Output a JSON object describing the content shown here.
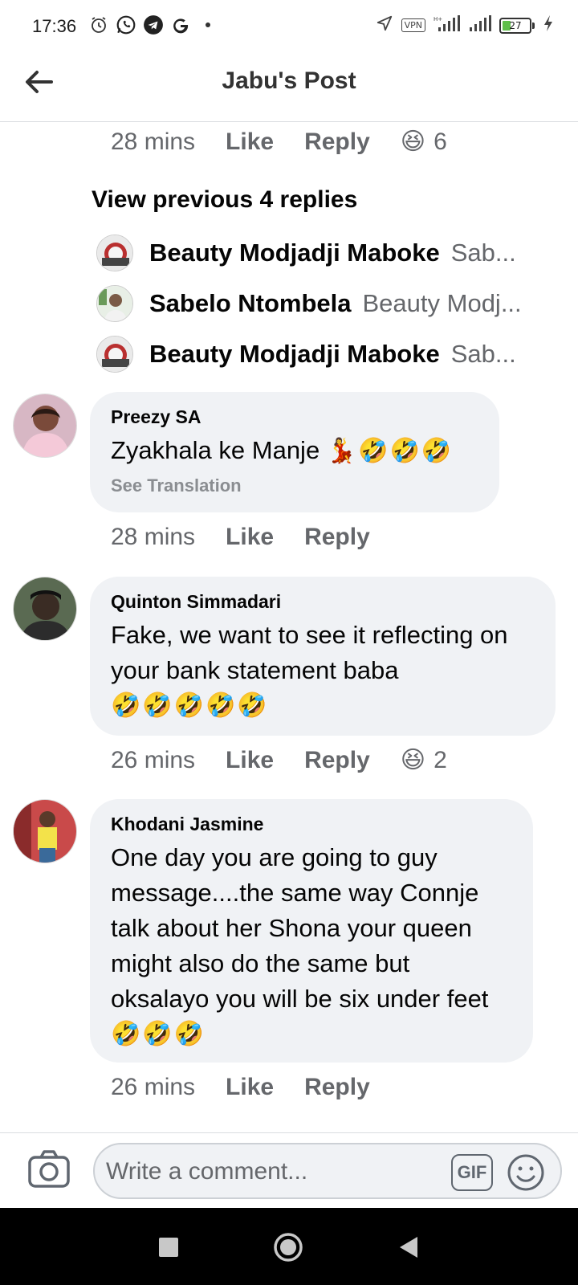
{
  "status_bar": {
    "time": "17:36",
    "left_icons": [
      "alarm-icon",
      "whatsapp-icon",
      "telegram-icon",
      "google-icon",
      "dot-icon"
    ],
    "vpn_label": "VPN",
    "battery_level": "27",
    "battery_fraction": 0.27
  },
  "header": {
    "title": "Jabu's Post",
    "back_icon": "back-arrow-icon"
  },
  "feed": {
    "top_meta": {
      "time": "28 mins",
      "like": "Like",
      "reply": "Reply",
      "reaction_emoji": "😆",
      "reaction_count": "6"
    },
    "view_previous": "View previous 4 replies",
    "replies": [
      {
        "name": "Beauty Modjadji Maboke",
        "snippet": "Sab..."
      },
      {
        "name": "Sabelo Ntombela",
        "snippet": "Beauty Modj..."
      },
      {
        "name": "Beauty Modjadji Maboke",
        "snippet": "Sab..."
      }
    ],
    "comments": [
      {
        "name": "Preezy SA",
        "text": "Zyakhala ke Manje",
        "emojis": "💃🤣🤣🤣",
        "see_translation": "See Translation",
        "time": "28 mins",
        "like": "Like",
        "reply": "Reply"
      },
      {
        "name": "Quinton Simmadari",
        "text": "Fake, we want to see it reflecting on your bank statement baba",
        "emojis": "🤣🤣🤣🤣🤣",
        "time": "26 mins",
        "like": "Like",
        "reply": "Reply",
        "reaction_emoji": "😆",
        "reaction_count": "2"
      },
      {
        "name": "Khodani Jasmine",
        "text": "One day you are going to guy message....the same way Connje talk about her Shona your queen might also do the same but oksalayo you will be six under feet",
        "emojis": "🤣🤣🤣",
        "time": "26 mins",
        "like": "Like",
        "reply": "Reply"
      }
    ]
  },
  "composer": {
    "placeholder": "Write a comment...",
    "gif_label": "GIF",
    "camera_icon": "camera-icon",
    "emoji_icon": "smiley-icon"
  },
  "nav_bar": {
    "icons": [
      "recents-square-icon",
      "home-circle-icon",
      "back-triangle-icon"
    ]
  },
  "colors": {
    "bubble": "#f0f2f5",
    "secondary_text": "#65676b",
    "divider": "#dadde1",
    "battery_fill": "#5fbf4a"
  }
}
